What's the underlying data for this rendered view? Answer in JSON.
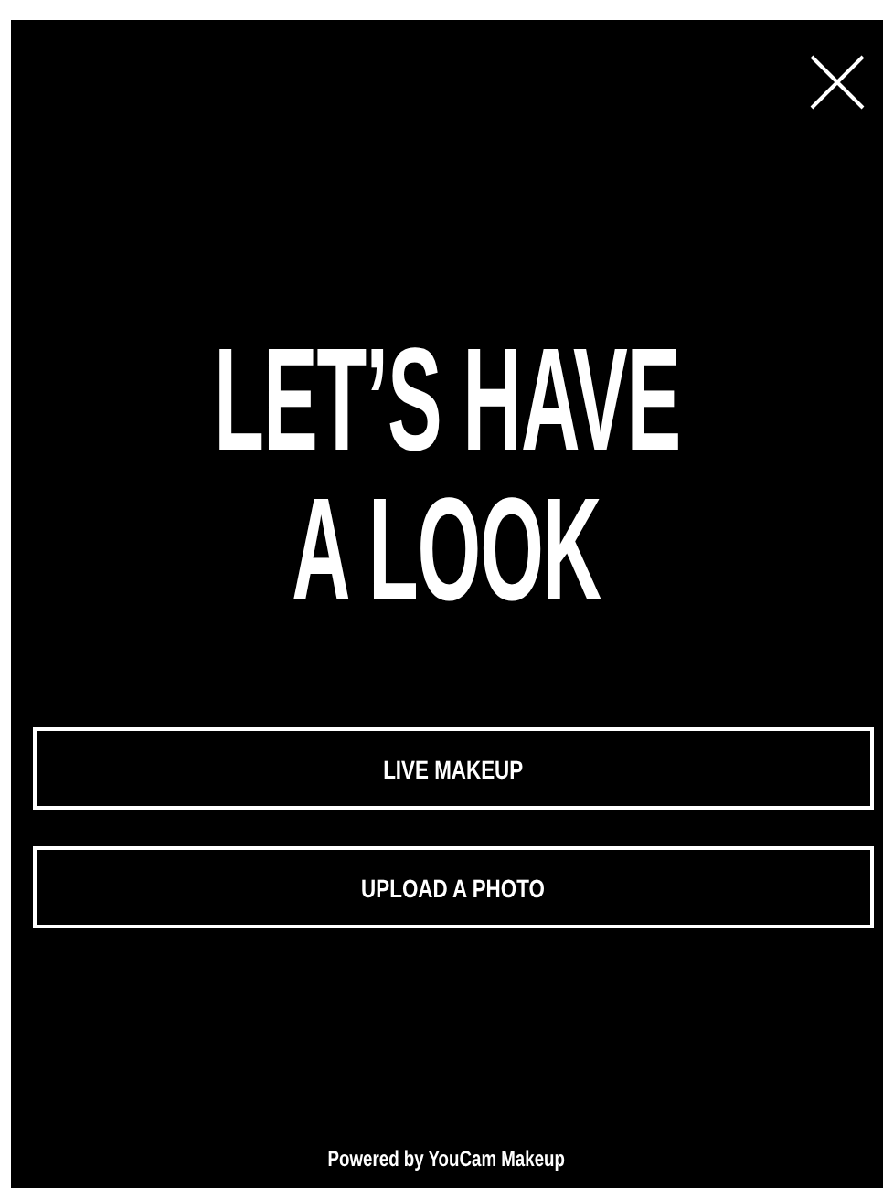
{
  "title_lines": [
    "LET’S HAVE",
    "A LOOK"
  ],
  "buttons": [
    {
      "label": "LIVE MAKEUP"
    },
    {
      "label": "UPLOAD A PHOTO"
    }
  ],
  "footer": "Powered by YouCam Makeup"
}
